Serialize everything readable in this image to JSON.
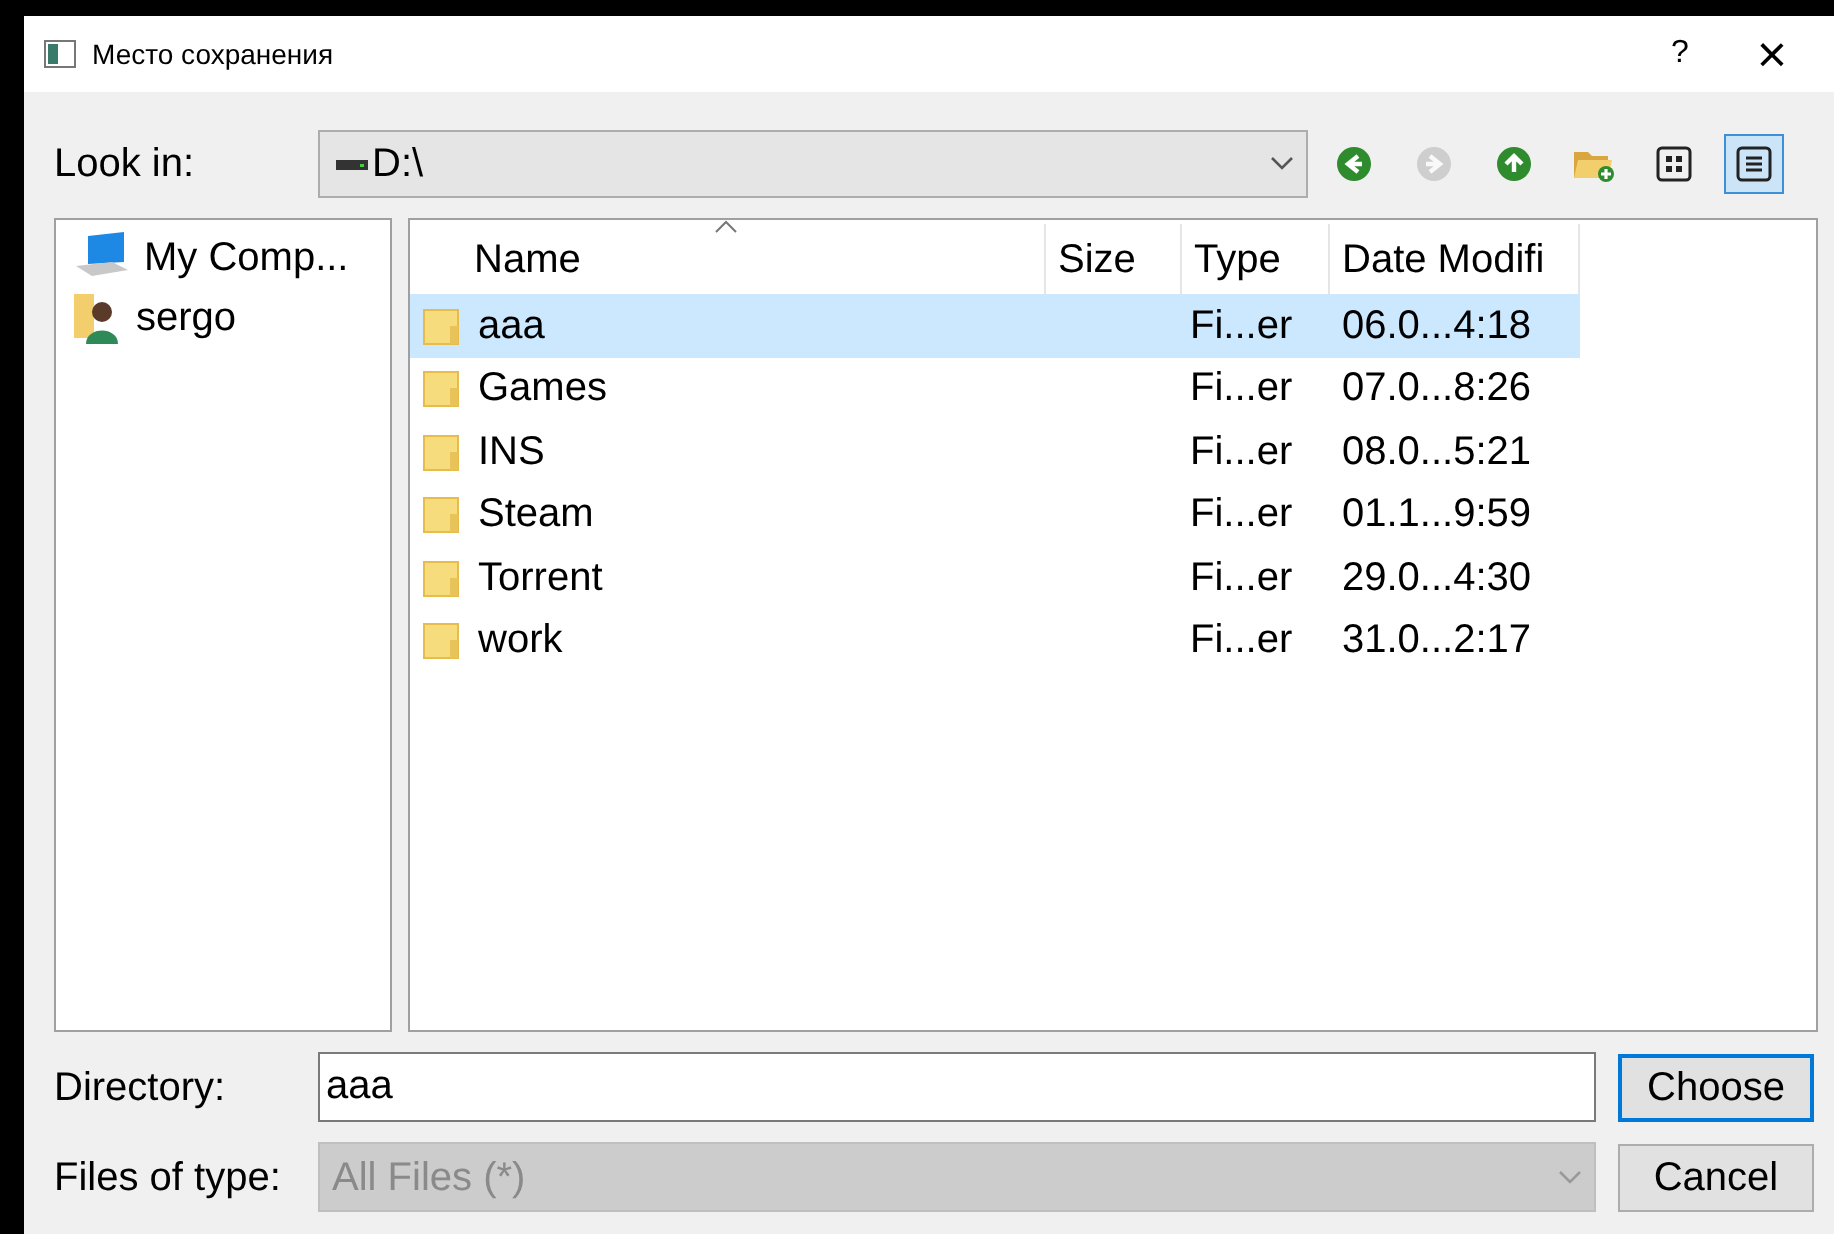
{
  "window": {
    "title": "Место сохранения",
    "help": "?",
    "close": "×"
  },
  "look_in": {
    "label": "Look in:",
    "value": "D:\\"
  },
  "toolbar": [
    {
      "kind": "back",
      "disabled": false,
      "selected": false
    },
    {
      "kind": "forward",
      "disabled": true,
      "selected": false
    },
    {
      "kind": "up",
      "disabled": false,
      "selected": false
    },
    {
      "kind": "new_folder",
      "disabled": false,
      "selected": false
    },
    {
      "kind": "list_view",
      "disabled": false,
      "selected": false
    },
    {
      "kind": "detail_view",
      "disabled": false,
      "selected": true
    }
  ],
  "sidebar": {
    "items": [
      {
        "kind": "computer",
        "label": "My Comp..."
      },
      {
        "kind": "user",
        "label": "sergo"
      }
    ]
  },
  "table": {
    "columns": [
      "Name",
      "Size",
      "Type",
      "Date Modifi"
    ],
    "rows": [
      {
        "name": "aaa",
        "type": "Fi...er",
        "date": "06.0...4:18",
        "selected": true
      },
      {
        "name": "Games",
        "type": "Fi...er",
        "date": "07.0...8:26",
        "selected": false
      },
      {
        "name": "INS",
        "type": "Fi...er",
        "date": "08.0...5:21",
        "selected": false
      },
      {
        "name": "Steam",
        "type": "Fi...er",
        "date": "01.1...9:59",
        "selected": false
      },
      {
        "name": "Torrent",
        "type": "Fi...er",
        "date": "29.0...4:30",
        "selected": false
      },
      {
        "name": "work",
        "type": "Fi...er",
        "date": "31.0...2:17",
        "selected": false
      }
    ]
  },
  "directory": {
    "label": "Directory:",
    "value": "aaa"
  },
  "file_type": {
    "label": "Files of type:",
    "value": "All Files (*)",
    "disabled": true
  },
  "buttons": [
    {
      "label": "Choose",
      "default": true
    },
    {
      "label": "Cancel",
      "default": false
    }
  ]
}
